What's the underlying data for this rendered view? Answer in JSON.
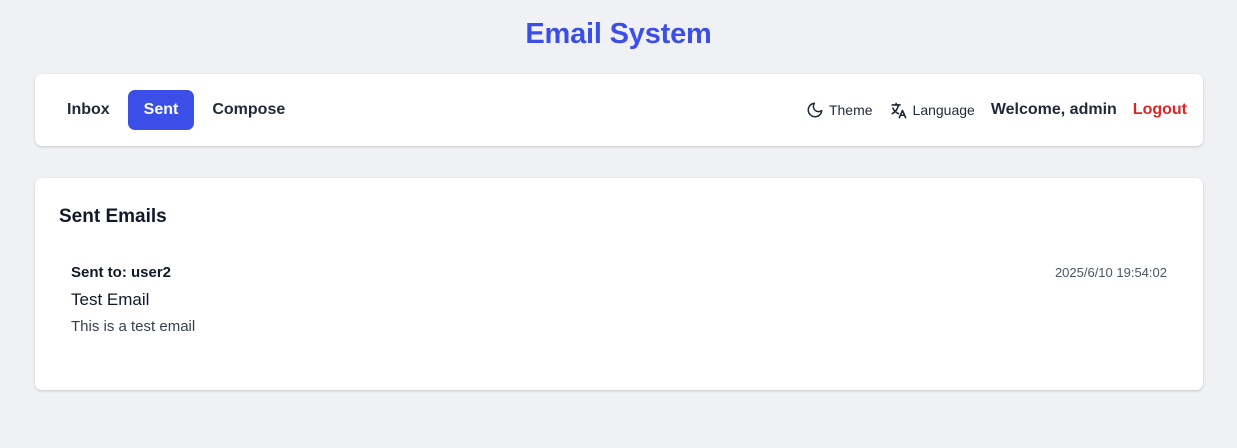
{
  "app": {
    "title": "Email System",
    "accent_color": "#3b4ee8",
    "danger_color": "#dc2626"
  },
  "nav": {
    "items": [
      {
        "label": "Inbox",
        "active": false
      },
      {
        "label": "Sent",
        "active": true
      },
      {
        "label": "Compose",
        "active": false
      }
    ],
    "theme": {
      "label": "Theme",
      "icon": "moon-icon"
    },
    "language": {
      "label": "Language",
      "icon": "translate-icon"
    },
    "welcome": "Welcome, admin",
    "logout": "Logout"
  },
  "sent": {
    "title": "Sent Emails",
    "emails": [
      {
        "to": "Sent to: user2",
        "date": "2025/6/10 19:54:02",
        "subject": "Test Email",
        "body": "This is a test email"
      }
    ]
  }
}
